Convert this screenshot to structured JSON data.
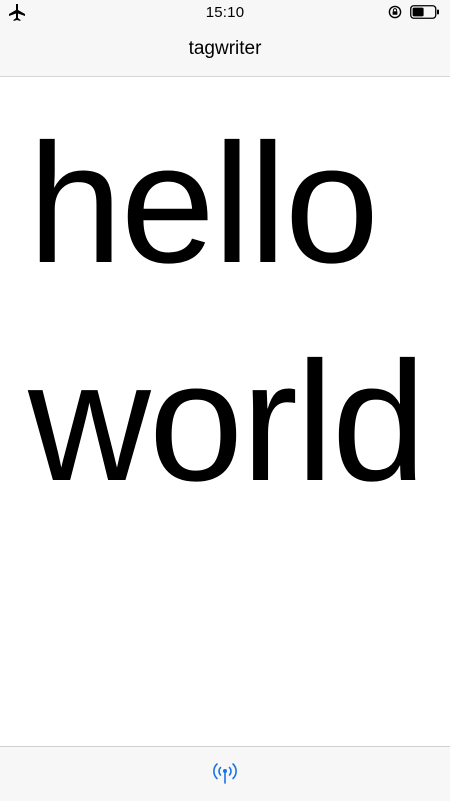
{
  "status_bar": {
    "time": "15:10",
    "left_icon": "airplane-icon",
    "right_icons": [
      "rotation-lock-icon",
      "battery-icon"
    ]
  },
  "nav": {
    "title": "tagwriter"
  },
  "content": {
    "text": "helloworld"
  },
  "tab_bar": {
    "items": [
      {
        "icon": "antenna-broadcast-icon",
        "color": "#1a73e8"
      }
    ]
  },
  "colors": {
    "bar_background": "#f7f7f7",
    "accent": "#1a73e8",
    "text": "#000000"
  }
}
